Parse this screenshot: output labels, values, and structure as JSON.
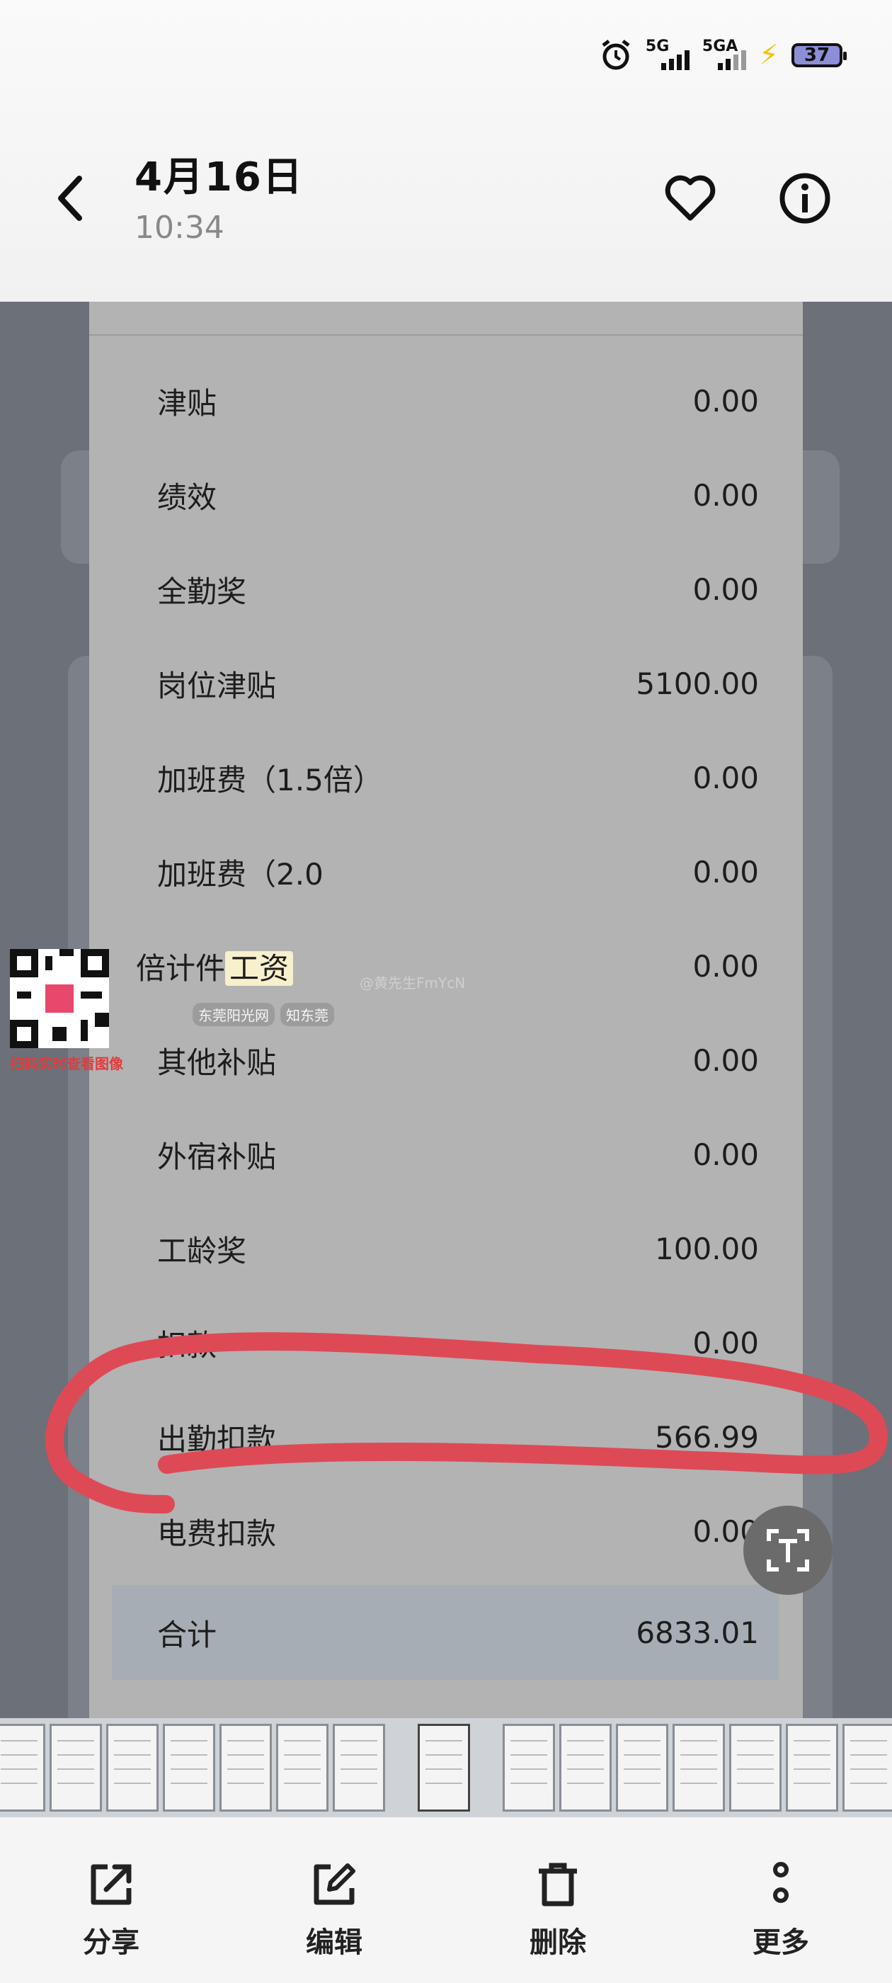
{
  "header": {
    "title": "4月16日",
    "subtitle": "10:34"
  },
  "status": {
    "net1": "5G",
    "net2": "5GA",
    "battery": "37"
  },
  "rows": [
    {
      "label": "津贴",
      "value": "0.00"
    },
    {
      "label": "绩效",
      "value": "0.00"
    },
    {
      "label": "全勤奖",
      "value": "0.00"
    },
    {
      "label": "岗位津贴",
      "value": "5100.00"
    },
    {
      "label": "加班费（1.5倍）",
      "value": "0.00"
    },
    {
      "label": "加班费（2.0",
      "value": "0.00"
    },
    {
      "label_pre": "倍计件",
      "label_hl": "工资",
      "value": "0.00"
    },
    {
      "label": "其他补贴",
      "value": "0.00"
    },
    {
      "label": "外宿补贴",
      "value": "0.00"
    },
    {
      "label": "工龄奖",
      "value": "100.00"
    },
    {
      "label": "扣款",
      "value": "0.00"
    },
    {
      "label": "出勤扣款",
      "value": "566.99"
    },
    {
      "label": "电费扣款",
      "value": "0.00"
    }
  ],
  "total": {
    "label": "合计",
    "value": "6833.01"
  },
  "watermark": {
    "qr_caption": "扫码实时查看图像",
    "user": "@黄先生FmYcN",
    "brand1": "东莞阳光网",
    "brand2": "知东莞"
  },
  "toolbar": [
    {
      "label": "分享",
      "icon": "share-icon"
    },
    {
      "label": "编辑",
      "icon": "edit-icon"
    },
    {
      "label": "删除",
      "icon": "delete-icon"
    },
    {
      "label": "更多",
      "icon": "more-icon"
    }
  ]
}
